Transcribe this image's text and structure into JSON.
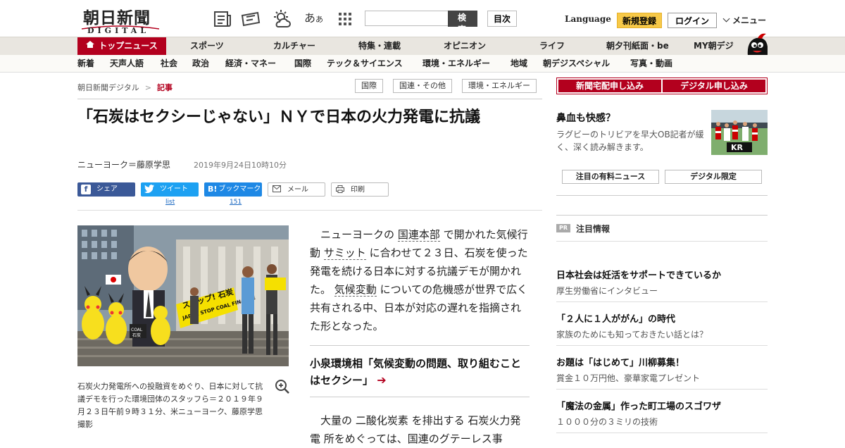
{
  "header": {
    "logo_kanji": "朝日新聞",
    "logo_sub": "DIGITAL",
    "aa_label": "あ",
    "aa_small": "あ",
    "search_button": "検 索",
    "toc_button": "目次",
    "language": "Language",
    "register": "新規登録",
    "login": "ログイン",
    "menu": "メニュー"
  },
  "nav_main": [
    "トップニュース",
    "スポーツ",
    "カルチャー",
    "特集・連載",
    "オピニオン",
    "ライフ",
    "朝夕刊紙面・be",
    "MY朝デジ"
  ],
  "nav_sub": [
    "新着",
    "天声人語",
    "社会",
    "政治",
    "経済・マネー",
    "国際",
    "テック＆サイエンス",
    "環境・エネルギー",
    "地域",
    "朝デジスペシャル",
    "写真・動画"
  ],
  "breadcrumb": {
    "home": "朝日新聞デジタル",
    "sep": ">",
    "current": "記事"
  },
  "tags": [
    "国際",
    "国連・その他",
    "環境・エネルギー"
  ],
  "article": {
    "headline": "「石炭はセクシーじゃない」ＮＹで日本の火力発電に抗議",
    "byline": "ニューヨーク＝藤原学思",
    "date": "2019年9月24日10時10分",
    "share": {
      "facebook": "シェア",
      "twitter": "ツイート",
      "hatena": "ブックマーク",
      "mail": "メール",
      "print": "印刷",
      "twitter_count": "list",
      "hatena_count": "151"
    },
    "photo_signs": {
      "sign1": "ストップ! 石炭",
      "sign2": "JAPAN STOP COAL FINANCE",
      "sign3": "COAL",
      "sign4": "石炭"
    },
    "caption": "石炭火力発電所への投融資をめぐり、日本に対して抗議デモを行った環境団体のスタッフら＝２０１９年９月２３日午前９時３１分、米ニューヨーク、藤原学思撮影",
    "p1": {
      "t1": "ニューヨークの",
      "l1": "国連本部",
      "t2": "で開かれた気候行動",
      "l2": "サミット",
      "t3": "に合わせて２３日、石炭を使った発電を続ける日本に対する抗議デモが開かれた。",
      "l3": "気候変動",
      "t4": "についての危機感が世界で広く共有される中、日本が対応の遅れを指摘された形となった。"
    },
    "related": "小泉環境相「気候変動の問題、取り組むことはセクシー」",
    "p2": {
      "t1": "大量の",
      "l1": "二酸化炭素",
      "t2": "を排出する",
      "l2": "石炭火力発電",
      "t3": "所をめぐっては、国連のグテーレス事"
    }
  },
  "sidebar": {
    "subscribe_paper": "新聞宅配申し込み",
    "subscribe_digital": "デジタル申し込み",
    "promo_title": "鼻血も快感？",
    "promo_desc": "ラグビーのトリビアを早大OB記者が緩く、深く読み解きます。",
    "promo_img_text": "KR",
    "btn_paid_news": "注目の有料ニュース",
    "btn_digital_only": "デジタル限定",
    "pr_badge": "PR",
    "pr_heading": "注目情報",
    "items": [
      {
        "title": "日本社会は妊活をサポートできているか",
        "desc": "厚生労働省にインタビュー"
      },
      {
        "title": "「２人に１人ががん」の時代",
        "desc": "家族のためにも知っておきたい話とは？"
      },
      {
        "title": "お題は「はじめて」川柳募集！",
        "desc": "賞金１０万円他、豪華家電プレゼント"
      },
      {
        "title": "「魔法の金属」作った町工場のスゴワザ",
        "desc": "１０００分の３ミリの技術"
      }
    ]
  },
  "colors": {
    "brand_red": "#b3001e",
    "register_yellow": "#f7c948",
    "facebook": "#3b5998",
    "twitter": "#1da1f2",
    "hatena": "#1e88e5"
  }
}
